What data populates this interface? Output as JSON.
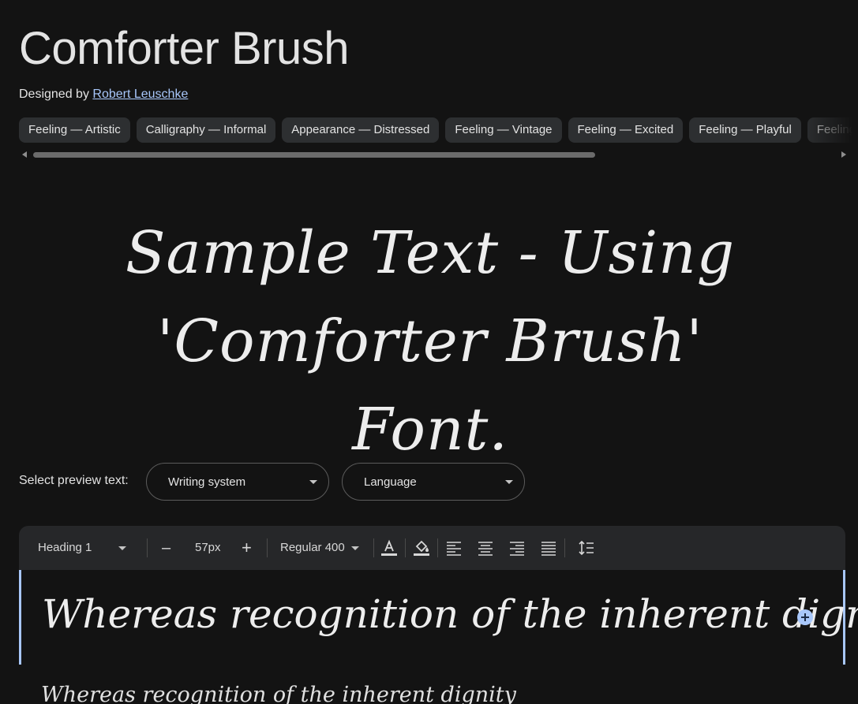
{
  "header": {
    "title": "Comforter Brush",
    "designed_by_prefix": "Designed by ",
    "designer_name": "Robert Leuschke"
  },
  "tags": [
    "Feeling — Artistic",
    "Calligraphy — Informal",
    "Appearance — Distressed",
    "Feeling — Vintage",
    "Feeling — Excited",
    "Feeling — Playful",
    "Feeling — Calm"
  ],
  "sample": {
    "line1": "Sample Text - Using 'Comforter Brush'",
    "line2": "Font."
  },
  "preview_select": {
    "label": "Select preview text:",
    "writing_system": "Writing system",
    "language": "Language"
  },
  "toolbar": {
    "style": "Heading 1",
    "minus": "–",
    "size": "57px",
    "plus": "+",
    "weight": "Regular 400"
  },
  "preview": {
    "heading_text": "Whereas recognition of the inherent dignity",
    "body_text": "Whereas recognition of the inherent dignity"
  },
  "colors": {
    "accent": "#a8c7fa",
    "background": "#131313",
    "chip": "#2d2f31",
    "toolbar": "#262729"
  }
}
